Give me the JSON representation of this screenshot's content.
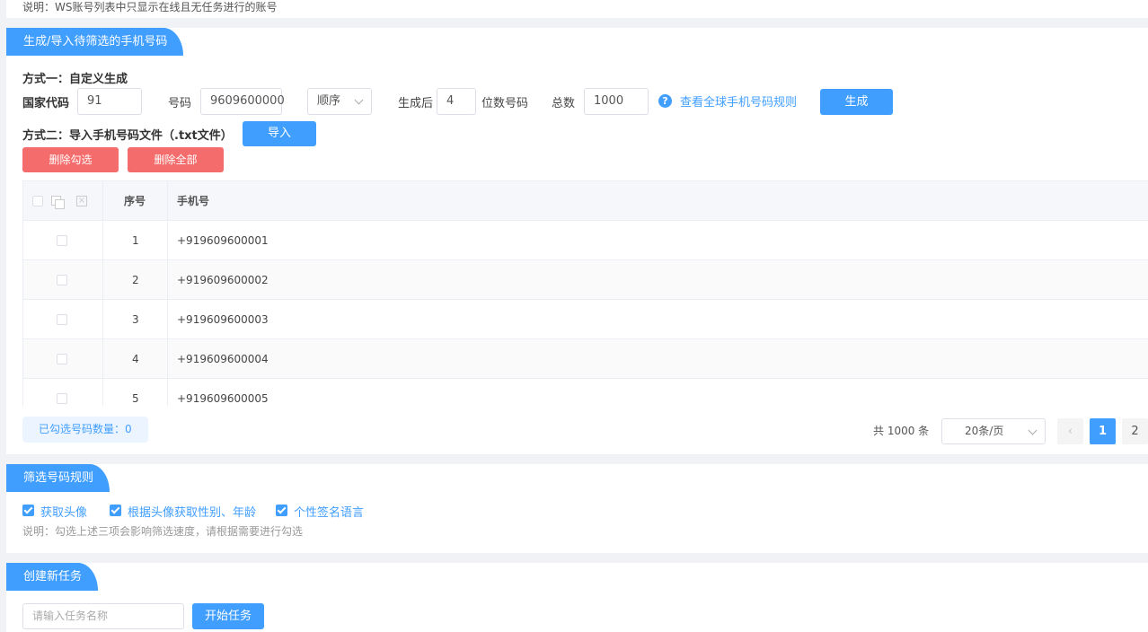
{
  "note": "说明：WS账号列表中只显示在线且无任务进行的账号",
  "generate_section": {
    "title": "生成/导入待筛选的手机号码",
    "method1_label": "方式一：自定义生成",
    "country_code_label": "国家代码",
    "country_code_value": "91",
    "number_label": "号码",
    "number_value": "9609600000",
    "order_select": "顺序",
    "generate_after_label": "生成后",
    "digits_value": "4",
    "digits_label": "位数号码",
    "total_label": "总数",
    "total_value": "1000",
    "rules_link": "查看全球手机号码规则",
    "generate_button": "生成",
    "method2_label": "方式二：导入手机号码文件（.txt文件）",
    "import_button": "导入",
    "delete_selected_button": "删除勾选",
    "delete_all_button": "删除全部"
  },
  "table": {
    "headers": {
      "index": "序号",
      "phone": "手机号"
    },
    "rows": [
      {
        "index": "1",
        "phone": "+919609600001"
      },
      {
        "index": "2",
        "phone": "+919609600002"
      },
      {
        "index": "3",
        "phone": "+919609600003"
      },
      {
        "index": "4",
        "phone": "+919609600004"
      },
      {
        "index": "5",
        "phone": "+919609600005"
      }
    ]
  },
  "footer": {
    "selected_count": "已勾选号码数量：0",
    "total": "共 1000 条",
    "page_size": "20条/页",
    "pages": [
      "1",
      "2"
    ],
    "current_page": 1
  },
  "filter_section": {
    "title": "筛选号码规则",
    "options": [
      "获取头像",
      "根据头像获取性别、年龄",
      "个性签名语言"
    ],
    "note": "说明：勾选上述三项会影响筛选速度，请根据需要进行勾选"
  },
  "task_section": {
    "title": "创建新任务",
    "name_placeholder": "请输入任务名称",
    "start_button": "开始任务"
  },
  "colors": {
    "primary": "#409eff",
    "danger": "#f56c6c"
  }
}
